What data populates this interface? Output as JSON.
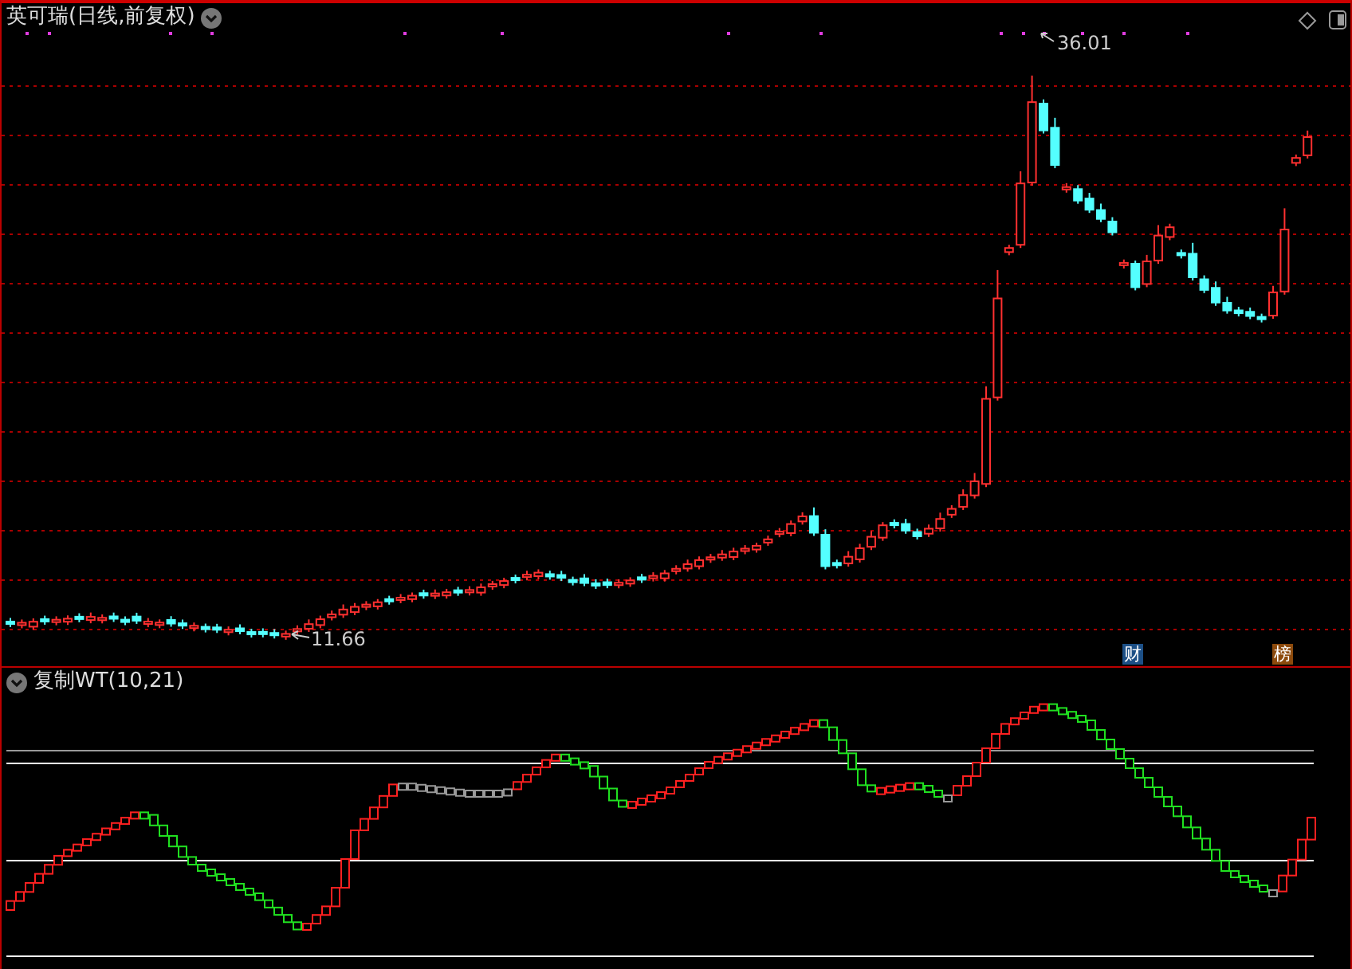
{
  "main_chart": {
    "title": "英可瑞(日线,前复权)",
    "high_label": "36.01",
    "low_label": "11.66",
    "badges": [
      {
        "text": "财",
        "color": "#1c4f86"
      },
      {
        "text": "榜",
        "color": "#8c4a0c"
      }
    ]
  },
  "indicator": {
    "title": "复制WT(10,21)"
  }
}
